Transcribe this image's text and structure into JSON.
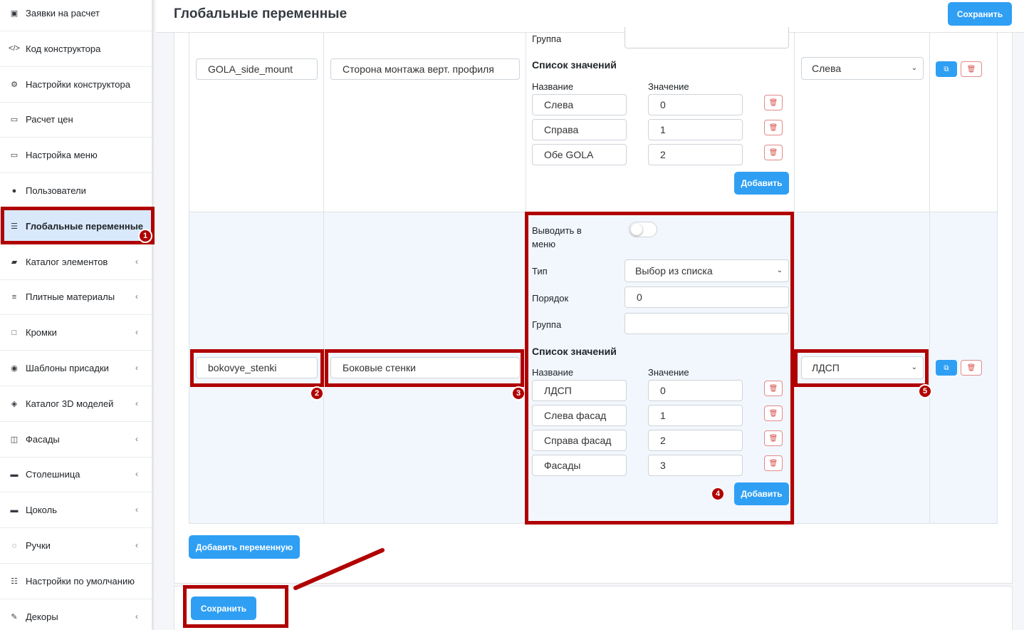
{
  "sidebar": {
    "items": [
      {
        "label": "Заявки на расчет",
        "icon": "clipboard-icon",
        "glyph": "▣",
        "chevron": false
      },
      {
        "label": "Код конструктора",
        "icon": "code-icon",
        "glyph": "</>",
        "chevron": false
      },
      {
        "label": "Настройки конструктора",
        "icon": "cogs-icon",
        "glyph": "⚙",
        "chevron": false
      },
      {
        "label": "Расчет цен",
        "icon": "money-icon",
        "glyph": "▭",
        "chevron": false
      },
      {
        "label": "Настройка меню",
        "icon": "desktop-icon",
        "glyph": "▭",
        "chevron": false
      },
      {
        "label": "Пользователи",
        "icon": "user-icon",
        "glyph": "●",
        "chevron": false
      },
      {
        "label": "Глобальные переменные",
        "icon": "list-icon",
        "glyph": "☰",
        "chevron": false,
        "active": true
      },
      {
        "label": "Каталог элементов",
        "icon": "book-icon",
        "glyph": "▰",
        "chevron": true
      },
      {
        "label": "Плитные материалы",
        "icon": "bars-icon",
        "glyph": "≡",
        "chevron": true
      },
      {
        "label": "Кромки",
        "icon": "square-icon",
        "glyph": "□",
        "chevron": true
      },
      {
        "label": "Шаблоны присадки",
        "icon": "dot-circle-icon",
        "glyph": "◉",
        "chevron": true
      },
      {
        "label": "Каталог 3D моделей",
        "icon": "cube-icon",
        "glyph": "◈",
        "chevron": true
      },
      {
        "label": "Фасады",
        "icon": "columns-icon",
        "glyph": "◫",
        "chevron": true
      },
      {
        "label": "Столешница",
        "icon": "minus-square-icon",
        "glyph": "▬",
        "chevron": true
      },
      {
        "label": "Цоколь",
        "icon": "minus-icon",
        "glyph": "▬",
        "chevron": true
      },
      {
        "label": "Ручки",
        "icon": "hand-icon",
        "glyph": "◌",
        "chevron": true
      },
      {
        "label": "Настройки по умолчанию",
        "icon": "sliders-icon",
        "glyph": "☷",
        "chevron": false
      },
      {
        "label": "Декоры",
        "icon": "brush-icon",
        "glyph": "✎",
        "chevron": true
      }
    ],
    "chevron_glyph": "‹"
  },
  "header": {
    "title": "Глобальные переменные",
    "save_label": "Сохранить"
  },
  "row1": {
    "key": "GOLA_side_mount",
    "name": "Сторона монтажа верт. профиля",
    "group_label": "Группа",
    "values_title": "Список значений",
    "col_name": "Название",
    "col_value": "Значение",
    "values": [
      {
        "name": "Слева",
        "value": "0"
      },
      {
        "name": "Справа",
        "value": "1"
      },
      {
        "name": "Обе GOLA",
        "value": "2"
      }
    ],
    "add_label": "Добавить",
    "default_value": "Слева"
  },
  "row2": {
    "key": "bokovye_stenki",
    "name": "Боковые стенки",
    "menu_label_1": "Выводить в",
    "menu_label_2": "меню",
    "type_label": "Тип",
    "type_value": "Выбор из списка",
    "order_label": "Порядок",
    "order_value": "0",
    "group_label": "Группа",
    "group_value": "",
    "values_title": "Список значений",
    "col_name": "Название",
    "col_value": "Значение",
    "values": [
      {
        "name": "ЛДСП",
        "value": "0"
      },
      {
        "name": "Слева фасад",
        "value": "1"
      },
      {
        "name": "Справа фасад",
        "value": "2"
      },
      {
        "name": "Фасады",
        "value": "3"
      }
    ],
    "add_label": "Добавить",
    "default_value": "ЛДСП"
  },
  "icons": {
    "copy": "⧉",
    "trash": "🗑",
    "caret": "⌄"
  },
  "add_variable_label": "Добавить переменную",
  "footer_save_label": "Сохранить",
  "annotations": [
    "1",
    "2",
    "3",
    "4",
    "5"
  ],
  "colors": {
    "primary": "#2f9ff4",
    "annotation_red": "#b00000",
    "active_bg": "#d9e8fb",
    "highlight_row_bg": "#f2f7fd"
  }
}
